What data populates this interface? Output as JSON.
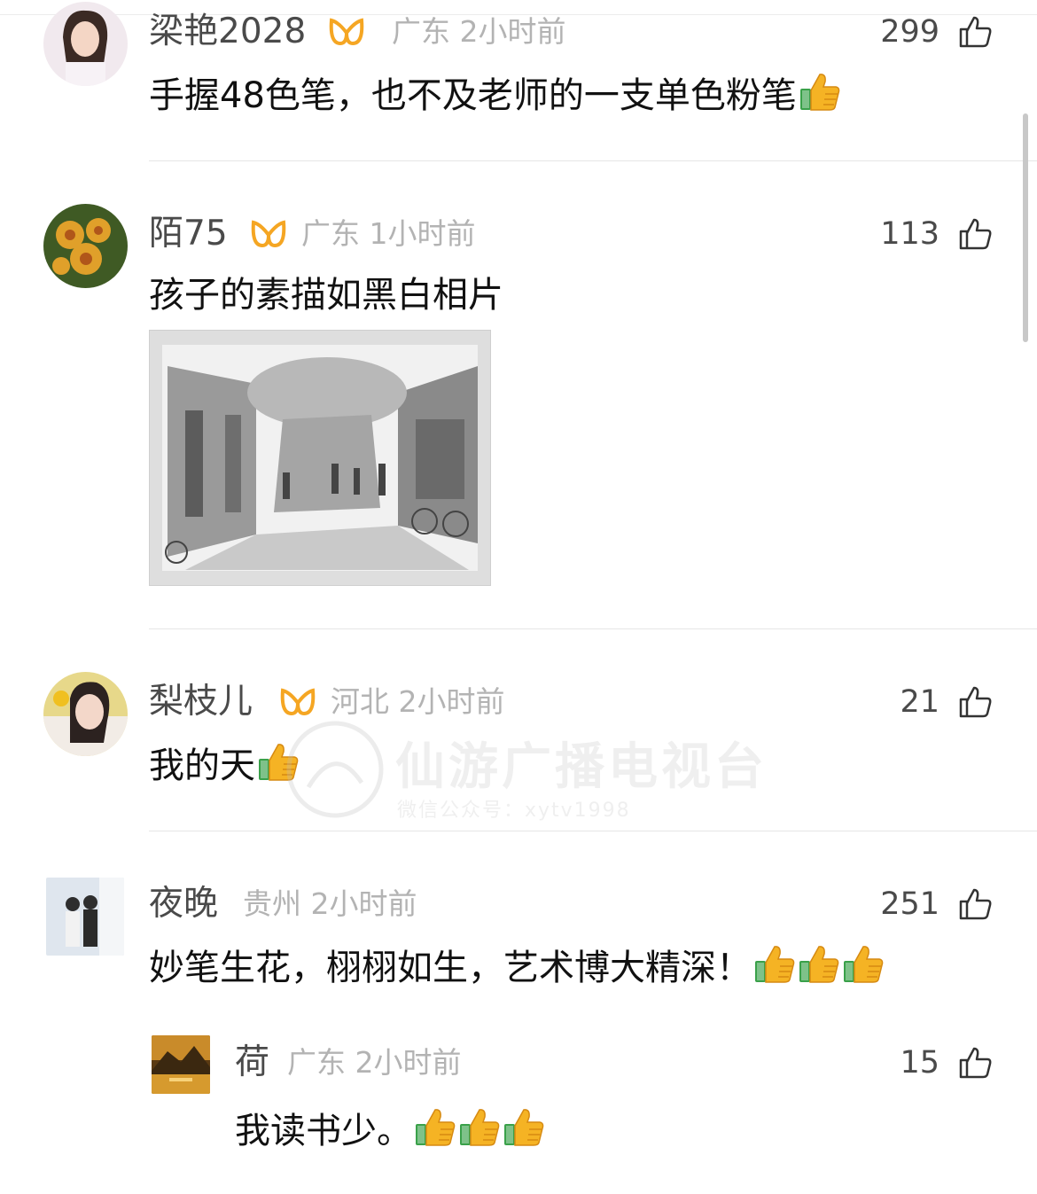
{
  "comments": [
    {
      "name": "梁艳2028",
      "vip": true,
      "location": "广东",
      "time": "2小时前",
      "likes": "299",
      "text": "手握48色笔，也不及老师的一支单色粉笔",
      "emoji_count": 1
    },
    {
      "name": "陌75",
      "vip": true,
      "location": "广东",
      "time": "1小时前",
      "likes": "113",
      "text": "孩子的素描如黑白相片",
      "emoji_count": 0
    },
    {
      "name": "梨枝儿",
      "vip": true,
      "location": "河北",
      "time": "2小时前",
      "likes": "21",
      "text": "我的天",
      "emoji_count": 1
    },
    {
      "name": "夜晚",
      "vip": false,
      "location": "贵州",
      "time": "2小时前",
      "likes": "251",
      "text": "妙笔生花，栩栩如生，艺术博大精深！",
      "emoji_count": 3
    },
    {
      "name": "荷",
      "vip": false,
      "location": "广东",
      "time": "2小时前",
      "likes": "15",
      "text": "我读书少。",
      "emoji_count": 3
    }
  ],
  "watermark": {
    "title": "仙游广播电视台",
    "subtitle": "微信公众号：xytv1998"
  },
  "colors": {
    "accent_vip": "#f5a623",
    "meta": "#b3b3b3",
    "text": "#111111"
  }
}
